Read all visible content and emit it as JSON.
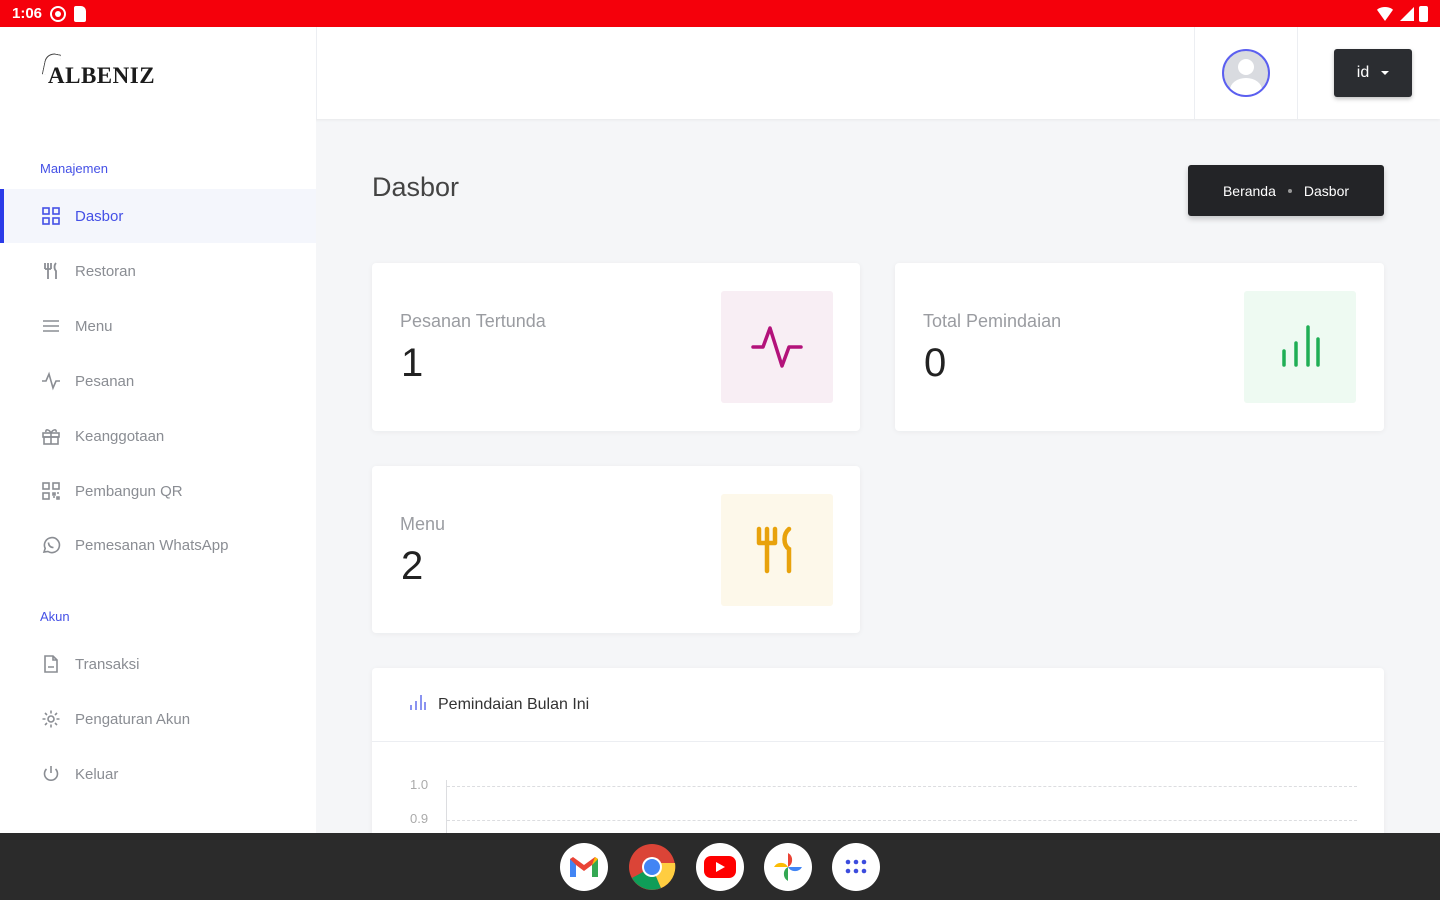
{
  "status_bar": {
    "time": "1:06"
  },
  "brand": {
    "logo_text": "ALBENIZ"
  },
  "header": {
    "language": "id"
  },
  "sidebar": {
    "section_management": "Manajemen",
    "section_account": "Akun",
    "items": [
      {
        "label": "Dasbor",
        "icon": "dashboard-icon"
      },
      {
        "label": "Restoran",
        "icon": "utensils-icon"
      },
      {
        "label": "Menu",
        "icon": "list-icon"
      },
      {
        "label": "Pesanan",
        "icon": "activity-icon"
      },
      {
        "label": "Keanggotaan",
        "icon": "gift-icon"
      },
      {
        "label": "Pembangun QR",
        "icon": "qr-icon"
      },
      {
        "label": "Pemesanan WhatsApp",
        "icon": "whatsapp-icon"
      }
    ],
    "account_items": [
      {
        "label": "Transaksi",
        "icon": "file-icon"
      },
      {
        "label": "Pengaturan Akun",
        "icon": "gear-icon"
      },
      {
        "label": "Keluar",
        "icon": "power-icon"
      }
    ]
  },
  "main": {
    "title": "Dasbor",
    "breadcrumb": [
      "Beranda",
      "Dasbor"
    ],
    "stats": [
      {
        "label": "Pesanan Tertunda",
        "value": "1",
        "icon": "activity-icon",
        "color": "#b3127a",
        "bg": "#f8eef4"
      },
      {
        "label": "Total Pemindaian",
        "value": "0",
        "icon": "bar-chart-icon",
        "color": "#1fae55",
        "bg": "#eefaf2"
      },
      {
        "label": "Menu",
        "value": "2",
        "icon": "utensils-icon",
        "color": "#e8a20c",
        "bg": "#fdf8ea"
      }
    ],
    "chart_title": "Pemindaian Bulan Ini"
  },
  "chart_data": {
    "type": "bar",
    "title": "Pemindaian Bulan Ini",
    "yticks": [
      "1.0",
      "0.9"
    ],
    "grid": true
  },
  "taskbar": {
    "apps": [
      "gmail-icon",
      "chrome-icon",
      "youtube-icon",
      "photos-icon",
      "app-launcher-icon"
    ]
  }
}
